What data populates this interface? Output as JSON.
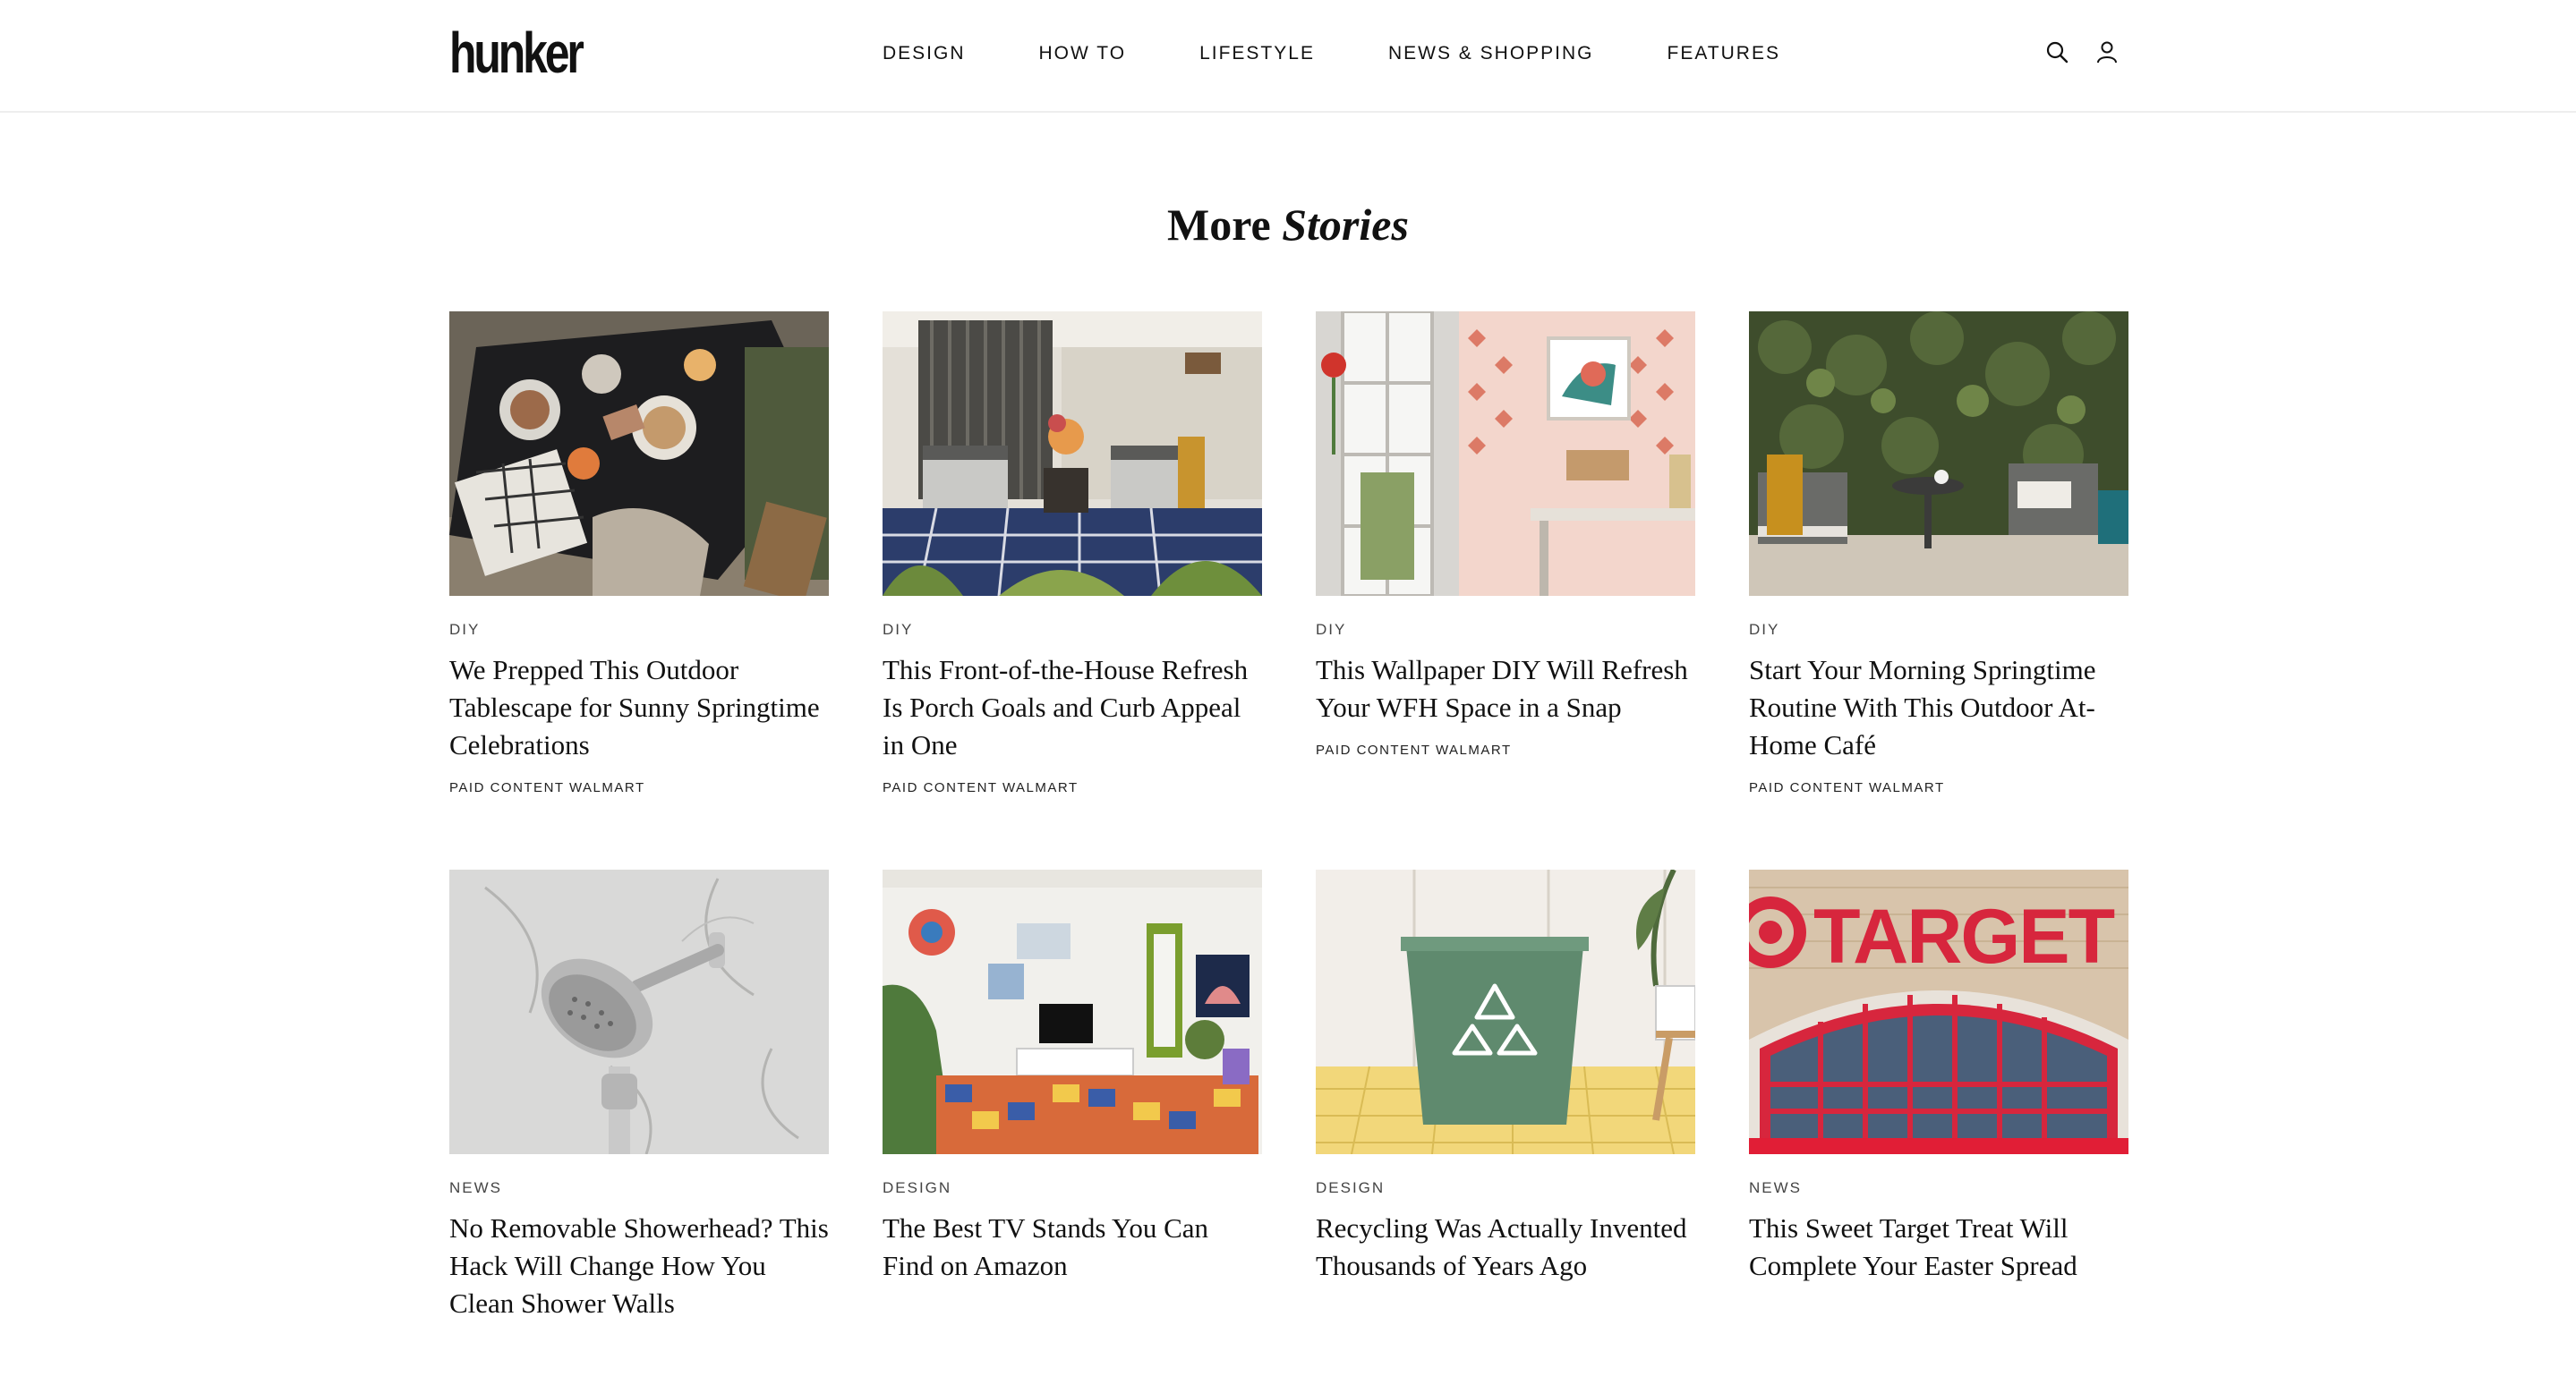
{
  "header": {
    "logo": "hunker",
    "logo_tm": "™",
    "nav": [
      "DESIGN",
      "HOW TO",
      "LIFESTYLE",
      "NEWS & SHOPPING",
      "FEATURES"
    ]
  },
  "section": {
    "title_regular": "More",
    "title_italic": "Stories"
  },
  "cards": [
    {
      "category": "DIY",
      "headline": "We Prepped This Outdoor Tablescape for Sunny Springtime Celebrations",
      "sponsor": "PAID CONTENT WALMART",
      "image": "outdoor-tablescape"
    },
    {
      "category": "DIY",
      "headline": "This Front-of-the-House Refresh Is Porch Goals and Curb Appeal in One",
      "sponsor": "PAID CONTENT WALMART",
      "image": "porch-chairs"
    },
    {
      "category": "DIY",
      "headline": "This Wallpaper DIY Will Refresh Your WFH Space in a Snap",
      "sponsor": "PAID CONTENT WALMART",
      "image": "wallpaper-desk"
    },
    {
      "category": "DIY",
      "headline": "Start Your Morning Springtime Routine With This Outdoor At-Home Café",
      "sponsor": "PAID CONTENT WALMART",
      "image": "outdoor-cafe"
    },
    {
      "category": "NEWS",
      "headline": "No Removable Showerhead? This Hack Will Change How You Clean Shower Walls",
      "sponsor": "",
      "image": "showerhead"
    },
    {
      "category": "DESIGN",
      "headline": "The Best TV Stands You Can Find on Amazon",
      "sponsor": "",
      "image": "tv-stand-room"
    },
    {
      "category": "DESIGN",
      "headline": "Recycling Was Actually Invented Thousands of Years Ago",
      "sponsor": "",
      "image": "recycling-bin"
    },
    {
      "category": "NEWS",
      "headline": "This Sweet Target Treat Will Complete Your Easter Spread",
      "sponsor": "",
      "image": "target-store"
    }
  ],
  "images": {
    "target_sign_text": "TARGET"
  },
  "colors": {
    "text": "#111111",
    "target_red": "#d7263d",
    "bin_green": "#5f8a6e"
  }
}
